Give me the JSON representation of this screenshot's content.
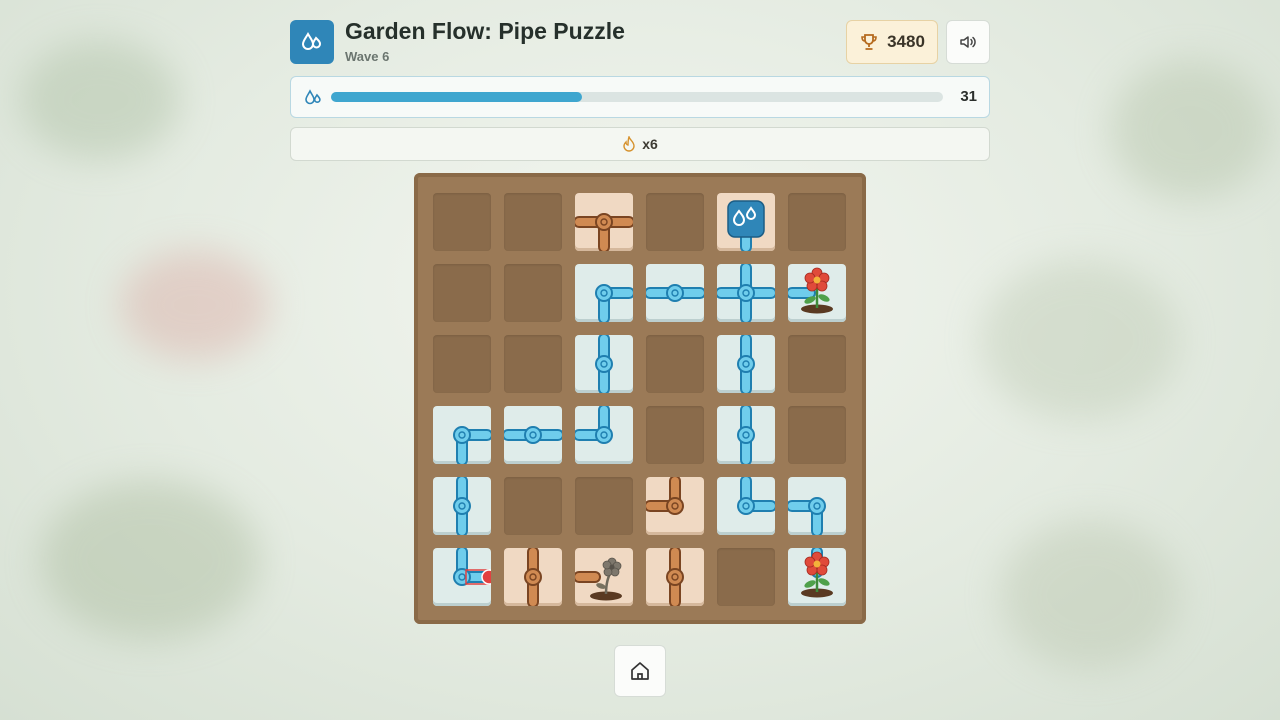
{
  "header": {
    "title": "Garden Flow: Pipe Puzzle",
    "subtitle": "Wave 6",
    "score": "3480",
    "app_icon": "water-drops-icon",
    "score_icon": "trophy-icon",
    "sound_icon": "speaker-icon"
  },
  "water": {
    "count": "31",
    "progress": 0.41,
    "icon": "water-drops-icon"
  },
  "combo": {
    "label": "x6",
    "icon": "flame-icon"
  },
  "colors": {
    "accent": "#2f86b8",
    "water": "#3fb4dc",
    "dry_pipe": "#c9864f",
    "board": "#9b7a57",
    "flower": "#e04a3a",
    "leak": "#e24040"
  },
  "board": {
    "rows": 6,
    "cols": 6,
    "cells": [
      {
        "r": 0,
        "c": 2,
        "kind": "dry",
        "conns": "ESW"
      },
      {
        "r": 0,
        "c": 4,
        "kind": "source",
        "conns": "S"
      },
      {
        "r": 1,
        "c": 2,
        "kind": "water",
        "conns": "ES"
      },
      {
        "r": 1,
        "c": 3,
        "kind": "water",
        "conns": "EW"
      },
      {
        "r": 1,
        "c": 4,
        "kind": "water",
        "conns": "NESW"
      },
      {
        "r": 1,
        "c": 5,
        "kind": "flower",
        "conns": "W"
      },
      {
        "r": 2,
        "c": 2,
        "kind": "water",
        "conns": "NS"
      },
      {
        "r": 2,
        "c": 4,
        "kind": "water",
        "conns": "NS"
      },
      {
        "r": 3,
        "c": 0,
        "kind": "water",
        "conns": "ES"
      },
      {
        "r": 3,
        "c": 1,
        "kind": "water",
        "conns": "EW"
      },
      {
        "r": 3,
        "c": 2,
        "kind": "water",
        "conns": "NW"
      },
      {
        "r": 3,
        "c": 4,
        "kind": "water",
        "conns": "NS"
      },
      {
        "r": 4,
        "c": 0,
        "kind": "water",
        "conns": "NS"
      },
      {
        "r": 4,
        "c": 2,
        "kind": "empty",
        "conns": ""
      },
      {
        "r": 4,
        "c": 3,
        "kind": "dry",
        "conns": "NW"
      },
      {
        "r": 4,
        "c": 4,
        "kind": "water",
        "conns": "NE"
      },
      {
        "r": 4,
        "c": 5,
        "kind": "water",
        "conns": "SW"
      },
      {
        "r": 5,
        "c": 0,
        "kind": "leak",
        "conns": "NE"
      },
      {
        "r": 5,
        "c": 1,
        "kind": "dry",
        "conns": "NS"
      },
      {
        "r": 5,
        "c": 2,
        "kind": "wilted",
        "conns": "W"
      },
      {
        "r": 5,
        "c": 3,
        "kind": "dry",
        "conns": "NS"
      },
      {
        "r": 5,
        "c": 5,
        "kind": "flower",
        "conns": "N"
      }
    ]
  },
  "home_icon": "home-icon"
}
